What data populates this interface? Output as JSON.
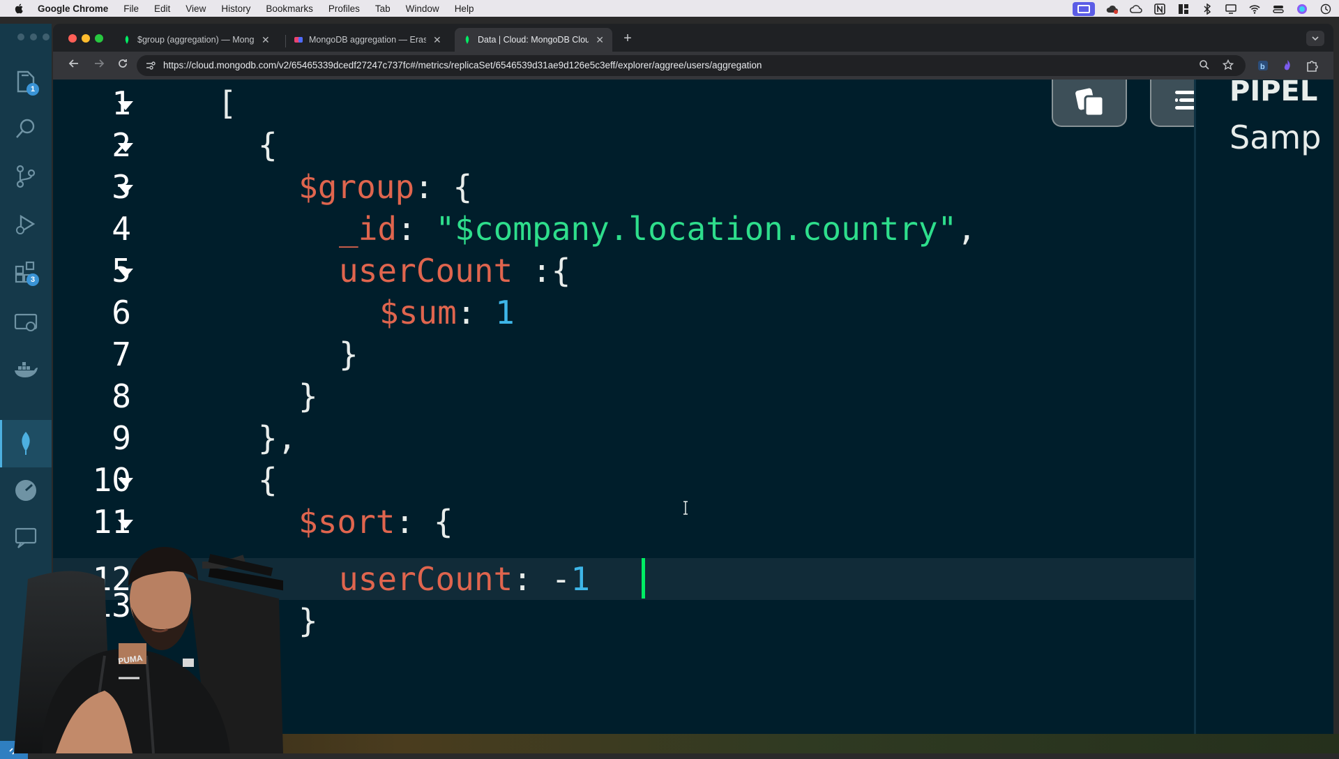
{
  "menubar": {
    "app_name": "Google Chrome",
    "items": [
      "File",
      "Edit",
      "View",
      "History",
      "Bookmarks",
      "Profiles",
      "Tab",
      "Window",
      "Help"
    ]
  },
  "activity_bar": {
    "explorer_badge": "1",
    "extensions_badge": "3"
  },
  "browser": {
    "tabs": [
      {
        "title": "$group (aggregation) — MongoDB",
        "active": false
      },
      {
        "title": "MongoDB aggregation — Eraser",
        "active": false
      },
      {
        "title": "Data | Cloud: MongoDB Cloud",
        "active": true
      }
    ],
    "new_tab_label": "+",
    "url": "https://cloud.mongodb.com/v2/65465339dcedf27247c737fc#/metrics/replicaSet/6546539d31ae9d126e5c3eff/explorer/aggree/users/aggregation"
  },
  "editor": {
    "line_numbers": [
      "1",
      "2",
      "3",
      "4",
      "5",
      "6",
      "7",
      "8",
      "9",
      "10",
      "11",
      "12",
      "13"
    ],
    "fold_lines": [
      1,
      2,
      3,
      5,
      10,
      11
    ],
    "line1": "[",
    "line2": "{",
    "line3_key": "$group",
    "line3_rest": ": {",
    "line4_key": "_id",
    "line4_colon": ": ",
    "line4_value": "\"$company.location.country\"",
    "line4_comma": ",",
    "line5_key": "userCount",
    "line5_rest": " :{",
    "line6_key": "$sum",
    "line6_colon": ": ",
    "line6_value": "1",
    "line7": "}",
    "line8": "}",
    "line9": "},",
    "line10": "{",
    "line11_key": "$sort",
    "line11_rest": ": {",
    "line12_key": "userCount",
    "line12_colon": ":",
    "line12_minus": " -",
    "line12_value": "1",
    "line14": "}"
  },
  "side_panel": {
    "title": "PIPEL",
    "subtitle": "Samp"
  },
  "colors": {
    "editor_bg": "#001e2b",
    "keyword": "#e0654e",
    "string": "#2ede8c",
    "number": "#3eb6e8",
    "cursor": "#00ed64"
  }
}
